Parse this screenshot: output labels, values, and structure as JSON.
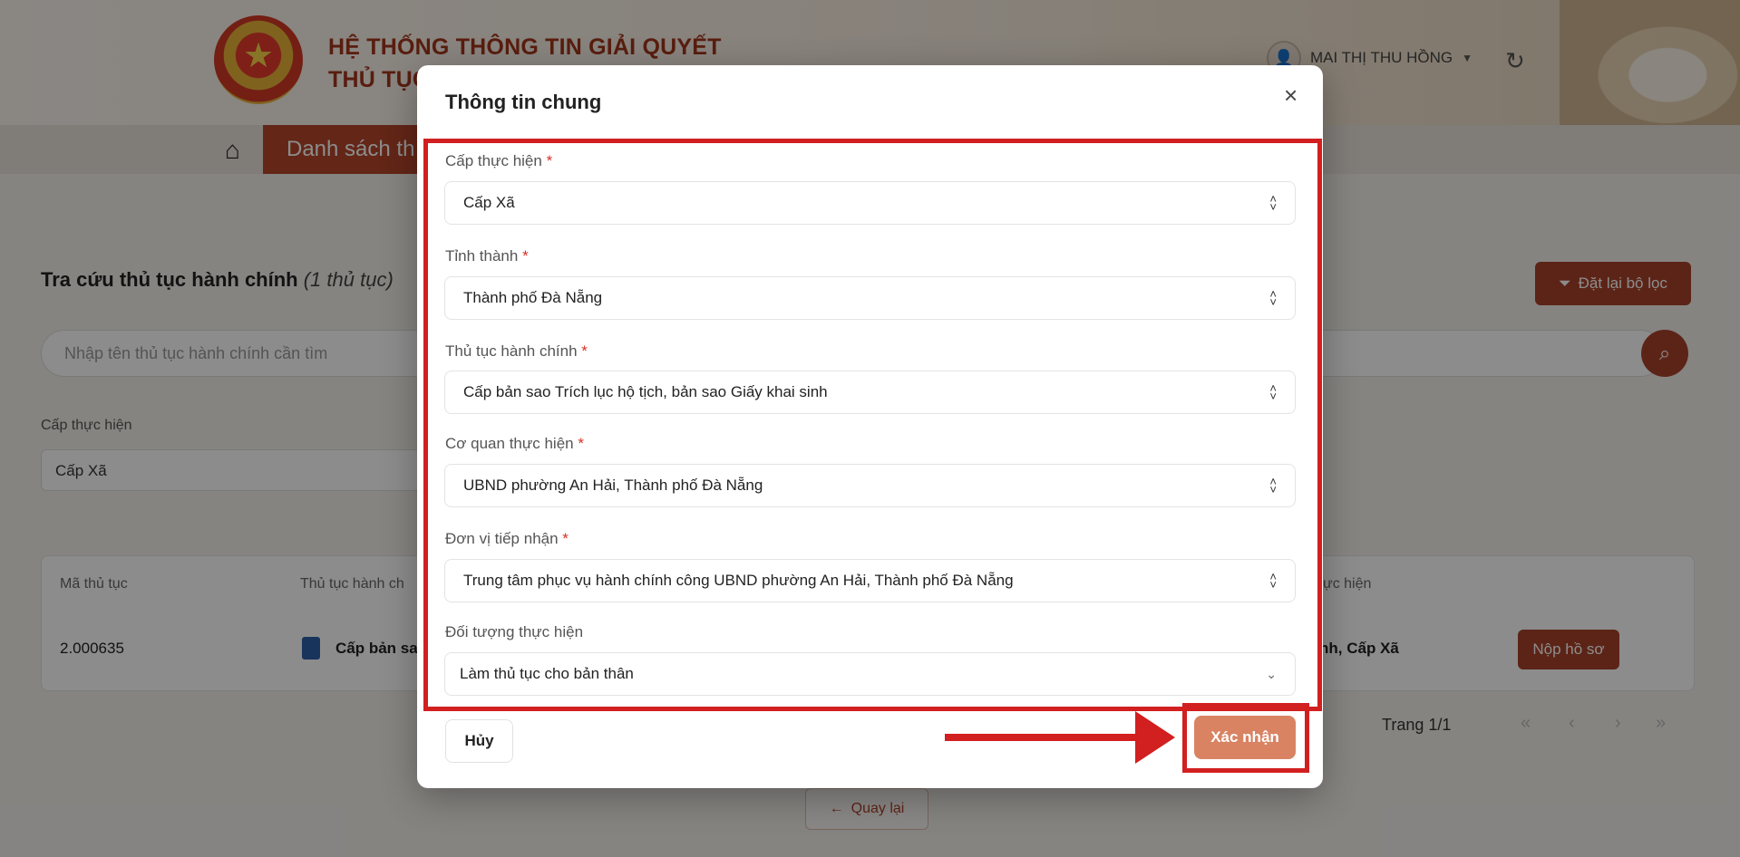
{
  "header": {
    "title_line1": "HỆ THỐNG THÔNG TIN GIẢI QUYẾT",
    "title_line2": "THỦ TỤC",
    "user_name": "MAI THỊ THU HỒNG",
    "icons": {
      "emblem": "state-emblem",
      "avatar": "avatar",
      "dropdown": "chevron-down-icon",
      "refresh": "refresh-icon"
    }
  },
  "nav": {
    "home_icon": "home-icon",
    "active_tab": "Danh sách th"
  },
  "search": {
    "title": "Tra cứu thủ tục hành chính",
    "count": "(1 thủ tục)",
    "reset_button": "Đặt lại bộ lọc",
    "placeholder": "Nhập tên thủ tục hành chính cần tìm",
    "filter_label": "Cấp thực hiện",
    "filter_value": "Cấp Xã"
  },
  "table": {
    "headers": [
      "Mã thủ tục",
      "Thủ tục hành ch",
      "ực hiện"
    ],
    "rows": [
      {
        "code": "2.000635",
        "name": "Cấp bản sao",
        "level": "nh, Cấp Xã",
        "action": "Nộp hồ sơ"
      }
    ],
    "pagination": "Trang 1/1",
    "pager_icons": [
      "«",
      "‹",
      "›",
      "»"
    ],
    "back_button": "Quay lại"
  },
  "modal": {
    "title": "Thông tin chung",
    "close_icon": "×",
    "fields": [
      {
        "label": "Cấp thực hiện",
        "required": "*",
        "value": "Cấp Xã",
        "control": "select"
      },
      {
        "label": "Tỉnh thành",
        "required": "*",
        "value": "Thành phố Đà Nẵng",
        "control": "select"
      },
      {
        "label": "Thủ tục hành chính",
        "required": "*",
        "value": "Cấp bản sao Trích lục hộ tịch, bản sao Giấy khai sinh",
        "control": "select"
      },
      {
        "label": "Cơ quan thực hiện",
        "required": "*",
        "value": "UBND phường An Hải, Thành phố Đà Nẵng",
        "control": "select"
      },
      {
        "label": "Đơn vị tiếp nhận",
        "required": "*",
        "value": "Trung tâm phục vụ hành chính công UBND phường An Hải, Thành phố Đà Nẵng",
        "control": "select"
      },
      {
        "label": "Đối tượng thực hiện",
        "required": "",
        "value": "Làm thủ tục cho bản thân",
        "control": "dropdown"
      }
    ],
    "cancel_button": "Hủy",
    "confirm_button": "Xác nhận"
  },
  "colors": {
    "brand": "#a8432a",
    "confirm": "#d98363",
    "annotation": "#d21f1f",
    "required": "#d93025"
  }
}
